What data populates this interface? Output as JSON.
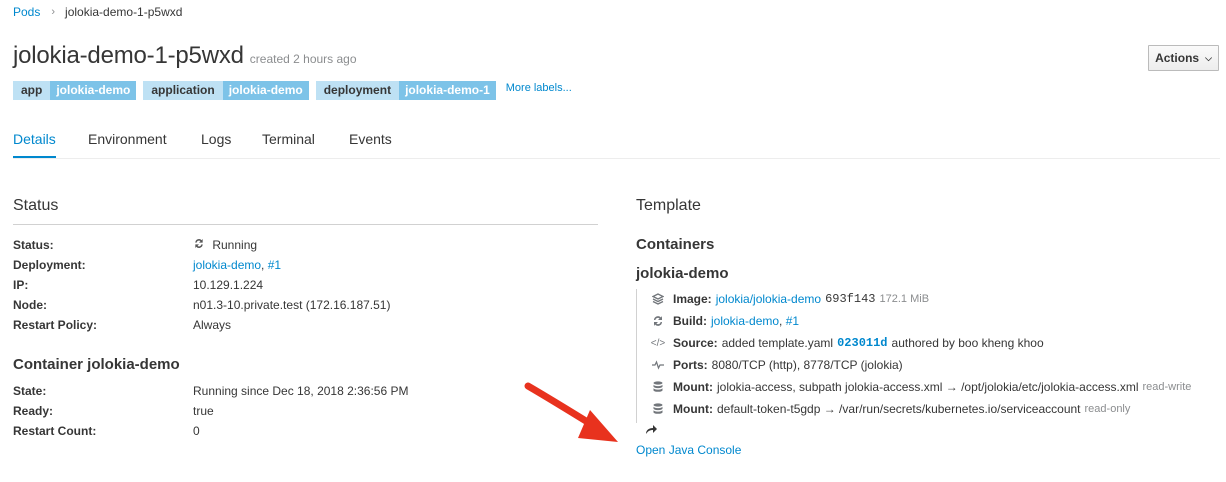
{
  "breadcrumb": {
    "parent": "Pods",
    "current": "jolokia-demo-1-p5wxd"
  },
  "header": {
    "title": "jolokia-demo-1-p5wxd",
    "created": "created 2 hours ago",
    "actions_label": "Actions"
  },
  "labels": [
    {
      "key": "app",
      "value": "jolokia-demo"
    },
    {
      "key": "application",
      "value": "jolokia-demo"
    },
    {
      "key": "deployment",
      "value": "jolokia-demo-1"
    }
  ],
  "more_labels": "More labels...",
  "tabs": [
    "Details",
    "Environment",
    "Logs",
    "Terminal",
    "Events"
  ],
  "status": {
    "heading": "Status",
    "rows": [
      {
        "label": "Status:",
        "value": "Running"
      },
      {
        "label": "Deployment:",
        "value": "jolokia-demo",
        "value2": "#1"
      },
      {
        "label": "IP:",
        "value": "10.129.1.224"
      },
      {
        "label": "Node:",
        "value": "n01.3-10.private.test (172.16.187.51)"
      },
      {
        "label": "Restart Policy:",
        "value": "Always"
      }
    ]
  },
  "container_status": {
    "heading": "Container jolokia-demo",
    "rows": [
      {
        "label": "State:",
        "value": "Running since Dec 18, 2018 2:36:56 PM"
      },
      {
        "label": "Ready:",
        "value": "true"
      },
      {
        "label": "Restart Count:",
        "value": "0"
      }
    ]
  },
  "template": {
    "heading": "Template",
    "containers_heading": "Containers",
    "container_name": "jolokia-demo",
    "image": {
      "label": "Image:",
      "link": "jolokia/jolokia-demo",
      "hash": "693f143",
      "size": "172.1 MiB"
    },
    "build": {
      "label": "Build:",
      "link": "jolokia-demo",
      "link2": "#1"
    },
    "source": {
      "label": "Source:",
      "text": "added template.yaml",
      "commit": "023011d",
      "author": "authored by boo kheng khoo"
    },
    "ports": {
      "label": "Ports:",
      "text": "8080/TCP (http), 8778/TCP (jolokia)"
    },
    "mount1": {
      "label": "Mount:",
      "text": "jolokia-access, subpath jolokia-access.xml → /opt/jolokia/etc/jolokia-access.xml",
      "mode": "read-write"
    },
    "mount2": {
      "label": "Mount:",
      "text": "default-token-t5gdp → /var/run/secrets/kubernetes.io/serviceaccount",
      "mode": "read-only"
    },
    "java_console": "Open Java Console"
  },
  "colors": {
    "link": "#0088ce",
    "label_key_bg": "#bee1f4",
    "label_value_bg": "#7dc3e8",
    "arrow": "#e8321e"
  }
}
